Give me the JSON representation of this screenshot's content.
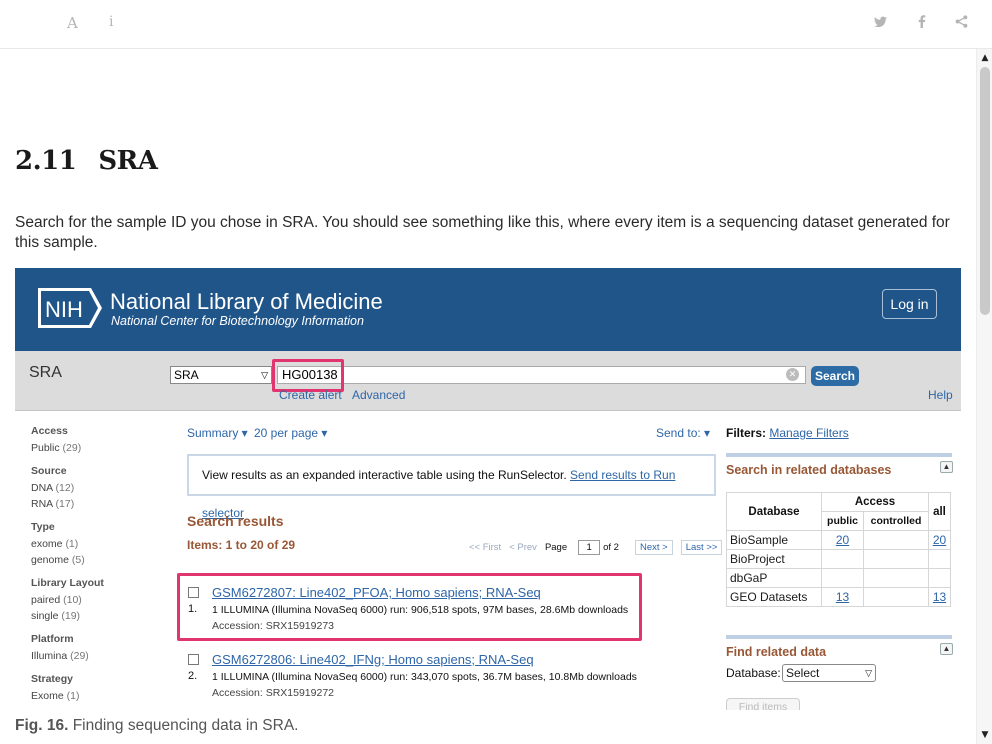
{
  "toolbar": {
    "font_icon": "A",
    "info_icon": "i",
    "twitter_icon": "twitter-icon",
    "facebook_icon": "facebook-icon",
    "share_icon": "share-icon"
  },
  "section": {
    "number": "2.11",
    "title": "SRA",
    "paragraph": "Search for the sample ID you chose in SRA. You should see something like this, where every item is a sequencing dataset generated for this sample."
  },
  "ncbi": {
    "logo_text": "NIH",
    "title": "National Library of Medicine",
    "subtitle": "National Center for Biotechnology Information",
    "login": "Log in",
    "db_label": "SRA",
    "db_select": "SRA",
    "query": "HG00138",
    "search_button": "Search",
    "create_alert": "Create alert",
    "advanced": "Advanced",
    "help": "Help"
  },
  "filters": [
    {
      "title": "Access",
      "items": [
        {
          "label": "Public",
          "count": "(29)"
        }
      ]
    },
    {
      "title": "Source",
      "items": [
        {
          "label": "DNA",
          "count": "(12)"
        },
        {
          "label": "RNA",
          "count": "(17)"
        }
      ]
    },
    {
      "title": "Type",
      "items": [
        {
          "label": "exome",
          "count": "(1)"
        },
        {
          "label": "genome",
          "count": "(5)"
        }
      ]
    },
    {
      "title": "Library Layout",
      "items": [
        {
          "label": "paired",
          "count": "(10)"
        },
        {
          "label": "single",
          "count": "(19)"
        }
      ]
    },
    {
      "title": "Platform",
      "items": [
        {
          "label": "Illumina",
          "count": "(29)"
        }
      ]
    },
    {
      "title": "Strategy",
      "items": [
        {
          "label": "Exome",
          "count": "(1)"
        }
      ]
    }
  ],
  "results": {
    "summary": "Summary ▾",
    "per_page": "20 per page ▾",
    "send_to": "Send to: ▾",
    "runselector_text": "View results as an expanded interactive table using the RunSelector. ",
    "runselector_link": "Send results to Run selector",
    "title": "Search results",
    "items": "Items: 1 to 20 of 29",
    "pager": {
      "first": "<< First",
      "prev": "< Prev",
      "page_label": "Page",
      "page": "1",
      "of": "of 2",
      "next": "Next >",
      "last": "Last >>"
    },
    "list": [
      {
        "index": "1.",
        "title": "GSM6272807: Line402_PFOA; Homo sapiens; RNA-Seq",
        "desc": "1 ILLUMINA (Illumina NovaSeq 6000) run: 906,518 spots, 97M bases, 28.6Mb downloads",
        "accession": "Accession: SRX15919273"
      },
      {
        "index": "2.",
        "title": "GSM6272806: Line402_IFNg; Homo sapiens; RNA-Seq",
        "desc": "1 ILLUMINA (Illumina NovaSeq 6000) run: 343,070 spots, 36.7M bases, 10.8Mb downloads",
        "accession": "Accession: SRX15919272"
      }
    ]
  },
  "right": {
    "filters_label": "Filters:",
    "manage_filters": "Manage Filters",
    "related_title": "Search in related databases",
    "table": {
      "h_database": "Database",
      "h_access": "Access",
      "h_all": "all",
      "h_public": "public",
      "h_controlled": "controlled",
      "rows": [
        {
          "db": "BioSample",
          "public": "20",
          "controlled": "",
          "all": "20"
        },
        {
          "db": "BioProject",
          "public": "",
          "controlled": "",
          "all": ""
        },
        {
          "db": "dbGaP",
          "public": "",
          "controlled": "",
          "all": ""
        },
        {
          "db": "GEO Datasets",
          "public": "13",
          "controlled": "",
          "all": "13"
        }
      ]
    },
    "find_title": "Find related data",
    "database_label": "Database:",
    "database_select": "Select",
    "find_items": "Find items"
  },
  "caption": {
    "label": "Fig. 16.",
    "text": " Finding sequencing data in SRA."
  },
  "colors": {
    "ncbi_blue": "#20558a",
    "highlight": "#e0356f",
    "result_brown": "#985735",
    "link_blue": "#2e66a8"
  }
}
